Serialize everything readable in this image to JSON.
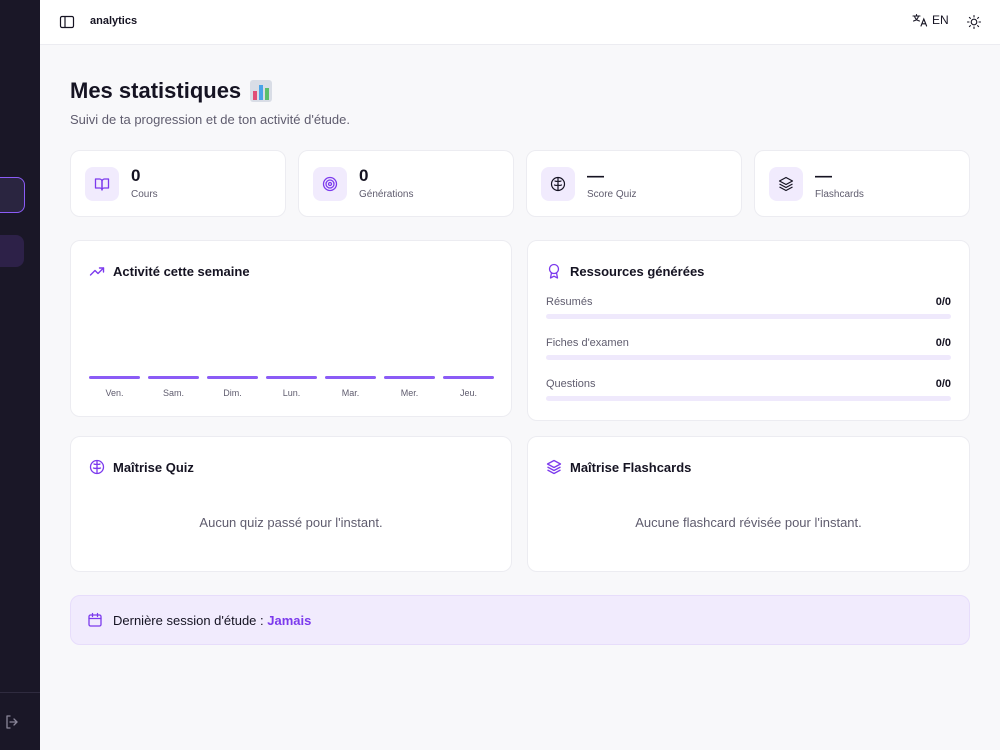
{
  "topbar": {
    "title": "analytics",
    "lang": "EN"
  },
  "header": {
    "title": "Mes statistiques",
    "title_emoji": "📊",
    "subtitle": "Suivi de ta progression et de ton activité d'étude."
  },
  "stats": [
    {
      "value": "0",
      "label": "Cours",
      "icon": "book-open-icon"
    },
    {
      "value": "0",
      "label": "Générations",
      "icon": "target-icon"
    },
    {
      "value": "—",
      "label": "Score Quiz",
      "icon": "brain-icon"
    },
    {
      "value": "—",
      "label": "Flashcards",
      "icon": "layers-icon"
    }
  ],
  "activity": {
    "title": "Activité cette semaine",
    "chart_data": {
      "type": "bar",
      "categories": [
        "Ven.",
        "Sam.",
        "Dim.",
        "Lun.",
        "Mar.",
        "Mer.",
        "Jeu."
      ],
      "values": [
        0,
        0,
        0,
        0,
        0,
        0,
        0
      ]
    }
  },
  "resources": {
    "title": "Ressources générées",
    "items": [
      {
        "label": "Résumés",
        "value": "0/0",
        "progress": 0
      },
      {
        "label": "Fiches d'examen",
        "value": "0/0",
        "progress": 0
      },
      {
        "label": "Questions",
        "value": "0/0",
        "progress": 0
      }
    ]
  },
  "quiz": {
    "title": "Maîtrise Quiz",
    "empty": "Aucun quiz passé pour l'instant."
  },
  "flashcards": {
    "title": "Maîtrise Flashcards",
    "empty": "Aucune flashcard révisée pour l'instant."
  },
  "session": {
    "label": "Dernière session d'étude :",
    "value": "Jamais"
  },
  "colors": {
    "accent": "#8b5cf6",
    "accent_soft": "#f1ebfd",
    "sidebar": "#1a1727"
  }
}
